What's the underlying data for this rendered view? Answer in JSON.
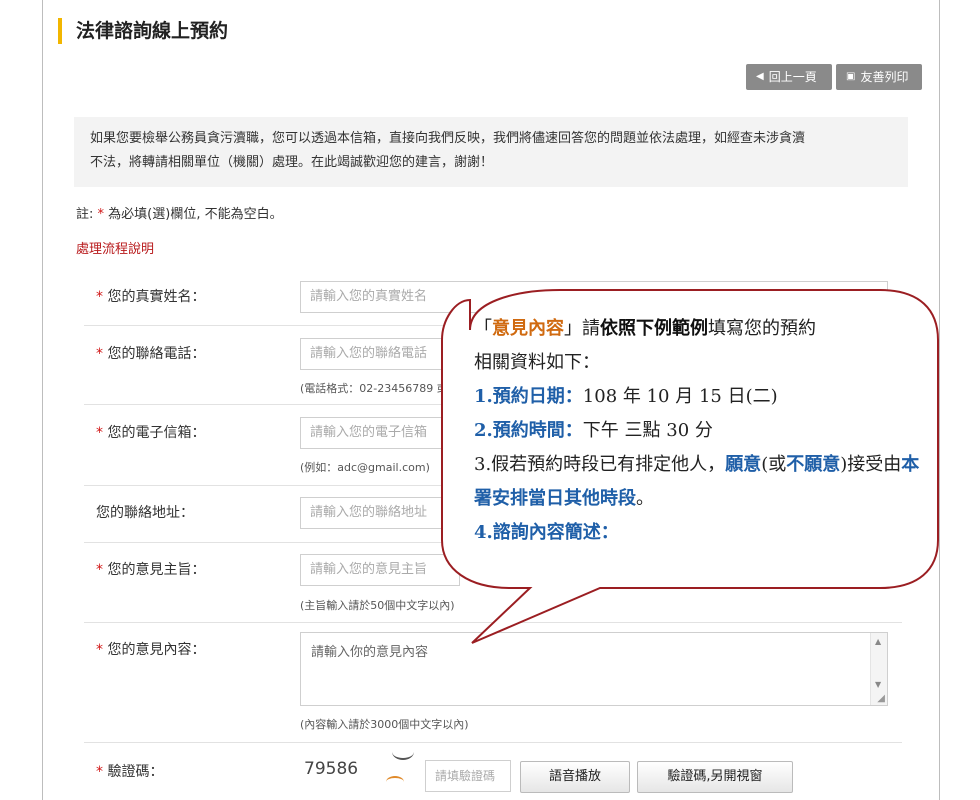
{
  "page": {
    "title": "法律諮詢線上預約",
    "back_label": "回上一頁",
    "print_label": "友善列印"
  },
  "intro": {
    "line1": "如果您要檢舉公務員貪污瀆職，您可以透過本信箱，直接向我們反映，我們將儘速回答您的問題並依法處理，如經查未涉貪瀆",
    "line2": "不法，將轉請相關單位（機關）處理。在此竭誠歡迎您的建言，謝謝！"
  },
  "note": {
    "prefix": "註:",
    "star": "*",
    "text": "為必填(選)欄位, 不能為空白。"
  },
  "process_link": "處理流程說明",
  "form": {
    "name": {
      "label": "您的真實姓名：",
      "placeholder": "請輸入您的真實姓名"
    },
    "phone": {
      "label": "您的聯絡電話：",
      "placeholder": "請輸入您的聯絡電話",
      "hint": "(電話格式：02-23456789 或"
    },
    "email": {
      "label": "您的電子信箱：",
      "placeholder": "請輸入您的電子信箱",
      "hint": "(例如：adc@gmail.com)"
    },
    "address": {
      "label": "您的聯絡地址：",
      "placeholder": "請輸入您的聯絡地址"
    },
    "subject": {
      "label": "您的意見主旨：",
      "placeholder": "請輸入您的意見主旨",
      "hint": "(主旨輸入請於50個中文字以內)"
    },
    "content": {
      "label": "您的意見內容：",
      "placeholder": "請輸入你的意見內容",
      "hint": "(內容輸入請於3000個中文字以內)"
    },
    "captcha": {
      "label": "驗證碼：",
      "code": "79586",
      "placeholder": "請填驗證碼"
    },
    "buttons": {
      "audio": "語音播放",
      "new_window": "驗證碼,另開視窗"
    },
    "star": "*"
  },
  "bubble": {
    "open_quote": "「",
    "highlight": "意見內容",
    "close_quote": "」請",
    "bold1": "依照下例範例",
    "rest1": "填寫您的預約",
    "line2": "相關資料如下：",
    "item1_label": "1.預約日期：",
    "item1_value": "108 年 10 月 15 日(二)",
    "item2_label": "2.預約時間：",
    "item2_value": "下午  三點 30 分",
    "item3_a": "3.假若預約時段已有排定他人，",
    "item3_willing": "願意",
    "item3_b": "(或",
    "item3_unwilling": "不願意",
    "item3_c": ")接受由",
    "item3_bold": "本署安排當日其他時段",
    "item3_end": "。",
    "item4_label": "4.諮詢內容簡述："
  },
  "colors": {
    "accent_bar": "#f2b600",
    "required": "#d01414",
    "link": "#b8191b",
    "bubble_border": "#9b1e22",
    "bubble_orange": "#d06a10",
    "bubble_blue": "#1f5fa8"
  }
}
